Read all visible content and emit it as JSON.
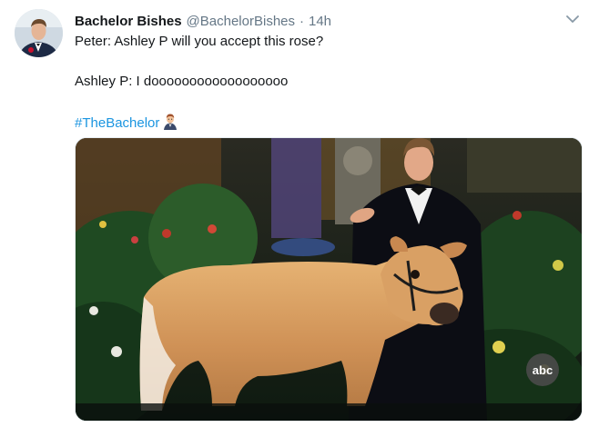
{
  "tweet": {
    "display_name": "Bachelor Bishes",
    "handle": "@BachelorBishes",
    "separator": "·",
    "time": "14h",
    "lines": [
      "Peter: Ashley P will you accept this rose?",
      "Ashley P: I doooooooooooooooooo"
    ],
    "hashtag": "#TheBachelor"
  },
  "media": {
    "network_logo_text": "abc"
  },
  "icons": {
    "avatar": "avatar-man-in-tuxedo",
    "menu": "chevron-down-icon",
    "hashtag_emoji": "man-in-tuxedo-emoji"
  },
  "colors": {
    "link": "#1b95e0",
    "secondary_text": "#657786",
    "primary_text": "#14171a"
  }
}
